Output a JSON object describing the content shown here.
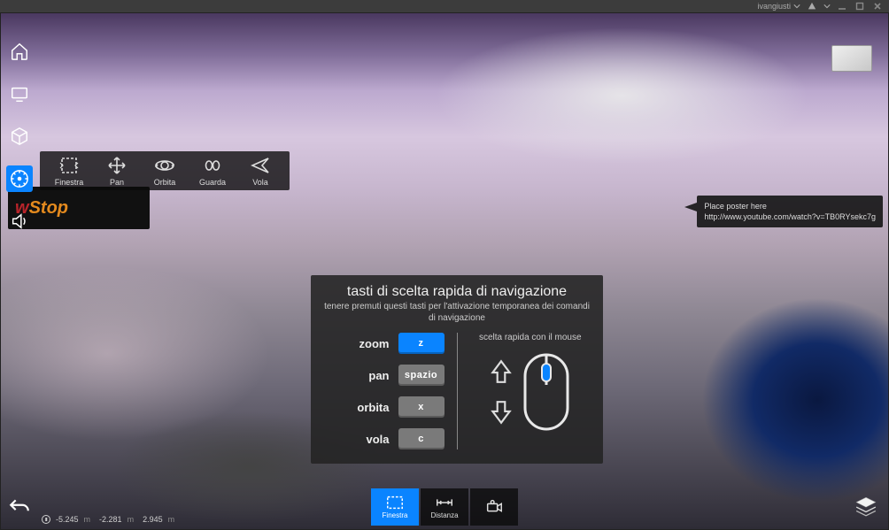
{
  "titlebar": {
    "username": "ivangiusti"
  },
  "left_tools": [
    {
      "name": "home-icon"
    },
    {
      "name": "monitor-icon"
    },
    {
      "name": "cube-icon"
    },
    {
      "name": "compass-icon",
      "active": true
    },
    {
      "name": "speaker-icon"
    }
  ],
  "nav_flyout": [
    {
      "name": "window-icon",
      "label": "Finestra"
    },
    {
      "name": "pan-icon",
      "label": "Pan"
    },
    {
      "name": "orbit-icon",
      "label": "Orbita"
    },
    {
      "name": "look-icon",
      "label": "Guarda"
    },
    {
      "name": "fly-icon",
      "label": "Vola"
    }
  ],
  "callout": {
    "line1": "Place poster here",
    "line2": "http://www.youtube.com/watch?v=TB0RYsekc7g"
  },
  "shortcuts": {
    "title": "tasti di scelta rapida di navigazione",
    "subtitle": "tenere premuti questi tasti per l'attivazione temporanea dei comandi di navigazione",
    "rows": [
      {
        "label": "zoom",
        "key": "z",
        "active": true
      },
      {
        "label": "pan",
        "key": "spazio"
      },
      {
        "label": "orbita",
        "key": "x"
      },
      {
        "label": "vola",
        "key": "c"
      }
    ],
    "mouse_hint": "scelta rapida con il mouse"
  },
  "bottom_tools": [
    {
      "name": "window-icon",
      "label": "Finestra",
      "active": true
    },
    {
      "name": "distance-icon",
      "label": "Distanza"
    },
    {
      "name": "camera-person-icon",
      "label": ""
    }
  ],
  "status": {
    "x": "-5.245",
    "x_unit": "m",
    "y": "-2.281",
    "y_unit": "m",
    "z": "2.945",
    "z_unit": "m"
  },
  "banner": {
    "part1": "w",
    "part2": "Stop"
  }
}
